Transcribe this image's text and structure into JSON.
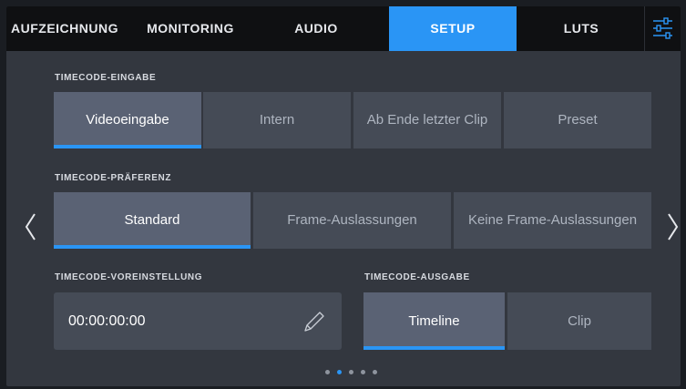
{
  "tabs": [
    {
      "label": "AUFZEICHNUNG",
      "active": false
    },
    {
      "label": "MONITORING",
      "active": false
    },
    {
      "label": "AUDIO",
      "active": false
    },
    {
      "label": "SETUP",
      "active": true
    },
    {
      "label": "LUTS",
      "active": false
    }
  ],
  "menu_icon": "sliders-icon",
  "timecode_input": {
    "label": "TIMECODE-EINGABE",
    "options": [
      "Videoeingabe",
      "Intern",
      "Ab Ende letzter Clip",
      "Preset"
    ],
    "selected": "Videoeingabe"
  },
  "timecode_preference": {
    "label": "TIMECODE-PRÄFERENZ",
    "options": [
      "Standard",
      "Frame-Auslassungen",
      "Keine Frame-Auslassungen"
    ],
    "selected": "Standard"
  },
  "timecode_preset": {
    "label": "TIMECODE-VOREINSTELLUNG",
    "value": "00:00:00:00",
    "edit_icon": "pencil-icon"
  },
  "timecode_output": {
    "label": "TIMECODE-AUSGABE",
    "options": [
      "Timeline",
      "Clip"
    ],
    "selected": "Timeline"
  },
  "pagination": {
    "pages": 5,
    "current": 2
  },
  "colors": {
    "accent": "#2a95f5",
    "panel": "#33373f",
    "tabbar": "#0f1012"
  }
}
